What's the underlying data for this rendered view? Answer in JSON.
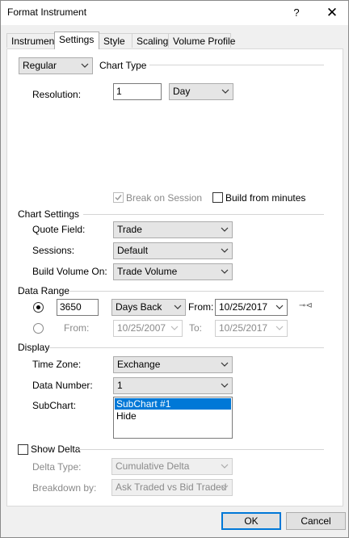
{
  "window": {
    "title": "Format Instrument",
    "help_glyph": "?",
    "close_glyph": "✕"
  },
  "tabs": [
    {
      "label": "Instrument"
    },
    {
      "label": "Settings",
      "active": true
    },
    {
      "label": "Style"
    },
    {
      "label": "Scaling"
    },
    {
      "label": "Volume Profile"
    }
  ],
  "chart_type": {
    "selected": "Regular",
    "label": "Chart Type"
  },
  "resolution": {
    "label": "Resolution:",
    "value": "1",
    "unit": "Day"
  },
  "options": {
    "break_on_session": "Break on Session",
    "build_from_minutes": "Build from minutes"
  },
  "chart_settings": {
    "header": "Chart Settings",
    "quote_field": {
      "label": "Quote Field:",
      "value": "Trade"
    },
    "sessions": {
      "label": "Sessions:",
      "value": "Default"
    },
    "build_volume_on": {
      "label": "Build Volume On:",
      "value": "Trade Volume"
    }
  },
  "data_range": {
    "header": "Data Range",
    "count": "3650",
    "mode": "Days Back",
    "from_label": "From:",
    "from_date": "10/25/2017",
    "link_glyph": "⊸⊲",
    "from2_label": "From:",
    "from2_date": "10/25/2007",
    "to_label": "To:",
    "to_date": "10/25/2017"
  },
  "display": {
    "header": "Display",
    "time_zone": {
      "label": "Time Zone:",
      "value": "Exchange"
    },
    "data_number": {
      "label": "Data Number:",
      "value": "1"
    },
    "subchart": {
      "label": "SubChart:",
      "items": [
        "SubChart #1",
        "Hide"
      ],
      "selected_index": 0
    }
  },
  "delta": {
    "header": "Show Delta",
    "delta_type": {
      "label": "Delta Type:",
      "value": "Cumulative Delta"
    },
    "breakdown_by": {
      "label": "Breakdown by:",
      "value": "Ask Traded vs Bid Traded"
    }
  },
  "buttons": {
    "ok": "OK",
    "cancel": "Cancel"
  },
  "colors": {
    "accent": "#0078d7",
    "dialog_bg": "#f0f0f0",
    "panel_bg": "#ffffff"
  }
}
